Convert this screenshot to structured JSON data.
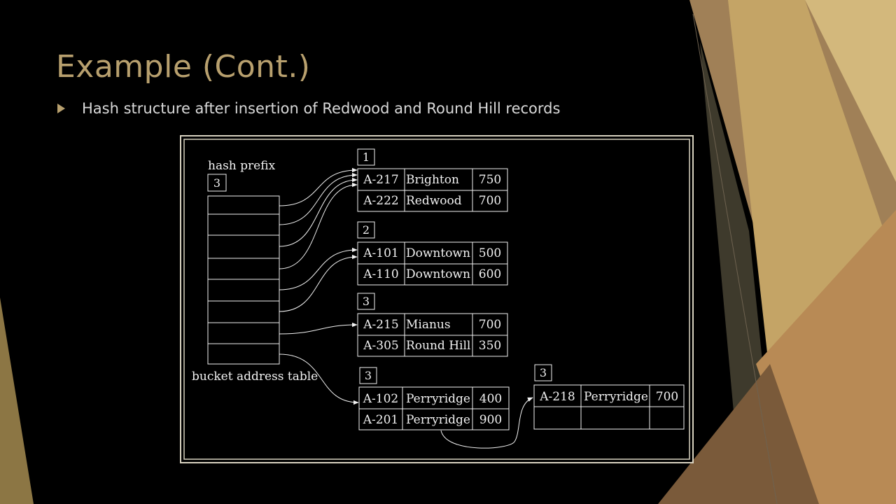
{
  "slide": {
    "title": "Example (Cont.)",
    "bullet": "Hash structure after insertion of Redwood and Round Hill records"
  },
  "figure": {
    "hash_prefix_label": "hash prefix",
    "global_depth": "3",
    "table_label": "bucket address table",
    "table_entries": 8,
    "buckets": [
      {
        "depth": "1",
        "records": [
          [
            "A-217",
            "Brighton",
            "750"
          ],
          [
            "A-222",
            "Redwood",
            "700"
          ]
        ]
      },
      {
        "depth": "2",
        "records": [
          [
            "A-101",
            "Downtown",
            "500"
          ],
          [
            "A-110",
            "Downtown",
            "600"
          ]
        ]
      },
      {
        "depth": "3",
        "records": [
          [
            "A-215",
            "Mianus",
            "700"
          ],
          [
            "A-305",
            "Round Hill",
            "350"
          ]
        ]
      },
      {
        "depth": "3",
        "records": [
          [
            "A-102",
            "Perryridge",
            "400"
          ],
          [
            "A-201",
            "Perryridge",
            "900"
          ]
        ]
      },
      {
        "depth": "3",
        "records": [
          [
            "A-218",
            "Perryridge",
            "700"
          ],
          [
            "",
            "",
            ""
          ]
        ]
      }
    ]
  },
  "colors": {
    "background": "#000000",
    "accent": "#B8A06E",
    "text": "#D9D9D9",
    "figure_line": "#F2F2F2"
  }
}
